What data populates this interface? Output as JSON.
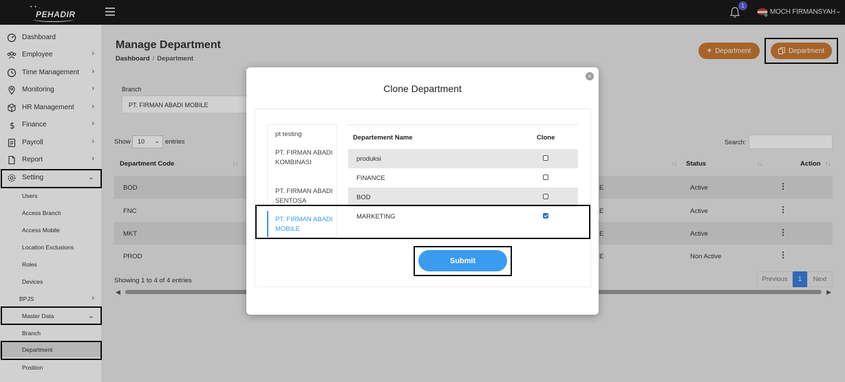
{
  "app": {
    "logo_text": "PEHADIR",
    "logo_dots": "• • ."
  },
  "topbar": {
    "notification_count": "1",
    "user_name": "MOCH FIRMANSYAH"
  },
  "sidebar": {
    "items": [
      {
        "label": "Dashboard",
        "icon": "dashboard-icon"
      },
      {
        "label": "Employee",
        "icon": "users-icon"
      },
      {
        "label": "Time Management",
        "icon": "clock-icon"
      },
      {
        "label": "Monitoring",
        "icon": "location-pin-icon"
      },
      {
        "label": "HR Management",
        "icon": "cube-icon"
      },
      {
        "label": "Finance",
        "icon": "dollar-icon"
      },
      {
        "label": "Payroll",
        "icon": "payroll-icon"
      },
      {
        "label": "Report",
        "icon": "document-icon"
      },
      {
        "label": "Setting",
        "icon": "gear-icon"
      }
    ],
    "setting_sub": [
      "Users",
      "Access Branch",
      "Access Mobile",
      "Location Exclusions",
      "Roles",
      "Devices"
    ],
    "bpjs": "BPJS",
    "master_data": "Master Data",
    "master_sub": [
      "Branch",
      "Department",
      "Position"
    ]
  },
  "page": {
    "title": "Manage Department",
    "breadcrumb_root": "Dashboard",
    "breadcrumb_sep": "/",
    "breadcrumb_current": "Department",
    "add_button": "Department",
    "clone_button": "Department"
  },
  "filter": {
    "branch_label": "Branch",
    "branch_value": "PT. FIRMAN ABADI MOBILE"
  },
  "table": {
    "show_label": "Show",
    "show_value": "10",
    "entries_label": "entries",
    "search_label": "Search:",
    "headers": {
      "code": "Department Code",
      "status": "Status",
      "action": "Action"
    },
    "rows": [
      {
        "code": "BOD",
        "mid": "E",
        "status": "Active"
      },
      {
        "code": "FNC",
        "mid": "E",
        "status": "Active"
      },
      {
        "code": "MKT",
        "mid": "E",
        "status": "Active"
      },
      {
        "code": "PROD",
        "mid": "E",
        "status": "Non Active"
      }
    ],
    "showing": "Showing 1 to 4 of 4 entries",
    "pager": {
      "previous": "Previous",
      "page": "1",
      "next": "Next"
    }
  },
  "modal": {
    "title": "Clone Department",
    "close": "×",
    "branches": [
      {
        "label": "pt testing"
      },
      {
        "label": "PT. FIRMAN ABADI KOMBINASI"
      },
      {
        "label": "PT. FIRMAN ABADI SENTOSA"
      },
      {
        "label": "PT. FIRMAN ABADI MOBILE"
      }
    ],
    "col_name": "Departement Name",
    "col_clone": "Clone",
    "departments": [
      {
        "name": "produksi",
        "checked": false
      },
      {
        "name": "FINANCE",
        "checked": false
      },
      {
        "name": "BOD",
        "checked": false
      },
      {
        "name": "MARKETING",
        "checked": true
      }
    ],
    "submit": "Submit"
  }
}
